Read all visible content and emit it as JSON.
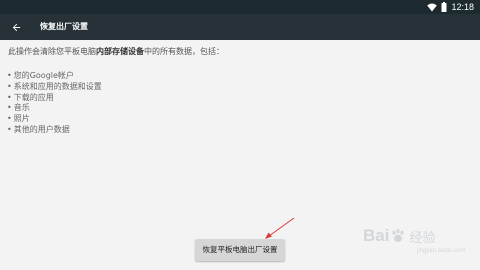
{
  "status_bar": {
    "time": "12:18",
    "background": "#1d2a30"
  },
  "app_bar": {
    "back_icon": "arrow-left-icon",
    "title": "恢复出厂设置",
    "background": "#263238"
  },
  "content": {
    "description_prefix": "此操作会清除您平板电脑",
    "description_bold": "内部存储设备",
    "description_suffix": "中的所有数据，包括：",
    "items": [
      "您的Google帐户",
      "系统和应用的数据和设置",
      "下载的应用",
      "音乐",
      "照片",
      "其他的用户数据"
    ],
    "bullet": "•"
  },
  "action": {
    "reset_label": "恢复平板电脑出厂设置",
    "button_color": "#d6d6d6"
  },
  "annotation": {
    "arrow_color": "#d93a3a"
  },
  "watermark": {
    "brand_left": "Bai",
    "brand_right": "经验",
    "subtext": "jingyan.baidu.com"
  }
}
